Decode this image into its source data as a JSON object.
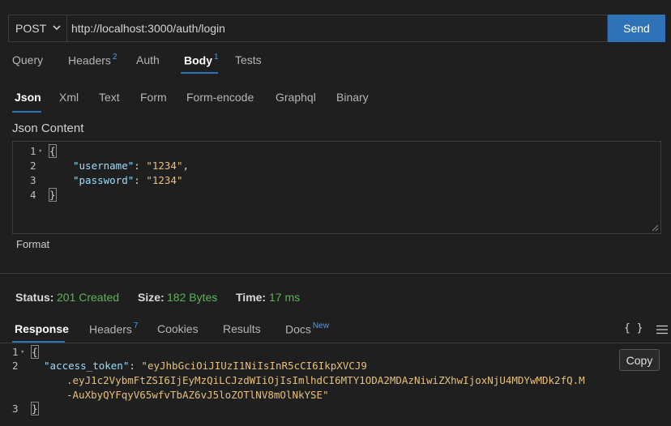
{
  "request": {
    "method": "POST",
    "url": "http://localhost:3000/auth/login",
    "send_label": "Send"
  },
  "request_tabs": [
    {
      "label": "Query"
    },
    {
      "label": "Headers",
      "badge": "2"
    },
    {
      "label": "Auth"
    },
    {
      "label": "Body",
      "badge": "1",
      "active": true
    },
    {
      "label": "Tests"
    }
  ],
  "body_tabs": [
    {
      "label": "Json",
      "active": true
    },
    {
      "label": "Xml"
    },
    {
      "label": "Text"
    },
    {
      "label": "Form"
    },
    {
      "label": "Form-encode"
    },
    {
      "label": "Graphql"
    },
    {
      "label": "Binary"
    }
  ],
  "json_content_label": "Json Content",
  "request_body": {
    "line_numbers": [
      "1",
      "2",
      "3",
      "4"
    ],
    "open_brace": "{",
    "close_brace": "}",
    "username_key": "\"username\"",
    "username_value": "\"1234\"",
    "password_key": "\"password\"",
    "password_value": "\"1234\""
  },
  "format_label": "Format",
  "status": {
    "status_label": "Status:",
    "status_value": "201 Created",
    "size_label": "Size:",
    "size_value": "182 Bytes",
    "time_label": "Time:",
    "time_value": "17 ms"
  },
  "response_tabs": [
    {
      "label": "Response",
      "active": true
    },
    {
      "label": "Headers",
      "badge": "7"
    },
    {
      "label": "Cookies"
    },
    {
      "label": "Results"
    },
    {
      "label": "Docs",
      "badge": "New"
    }
  ],
  "response_body": {
    "line_numbers": [
      "1",
      "2",
      "3"
    ],
    "open_brace": "{",
    "close_brace": "}",
    "token_key": "\"access_token\"",
    "token_line1": "\"eyJhbGciOiJIUzI1NiIsInR5cCI6IkpXVCJ9",
    "token_line2": ".eyJ1c2VybmFtZSI6IjEyMzQiLCJzdWIiOjIsImlhdCI6MTY1ODA2MDAzNiwiZXhwIjoxNjU4MDYwMDk2fQ.M",
    "token_line3": "-AuXbyQYFqyV65wfvTbAZ6vJ5loZOTlNV8mOlNkYSE\""
  },
  "copy_label": "Copy",
  "braces_label": "{ }",
  "colors": {
    "accent": "#2f72b8",
    "success": "#5ab553",
    "string": "#e6c07b",
    "key": "#9cdcfe"
  }
}
